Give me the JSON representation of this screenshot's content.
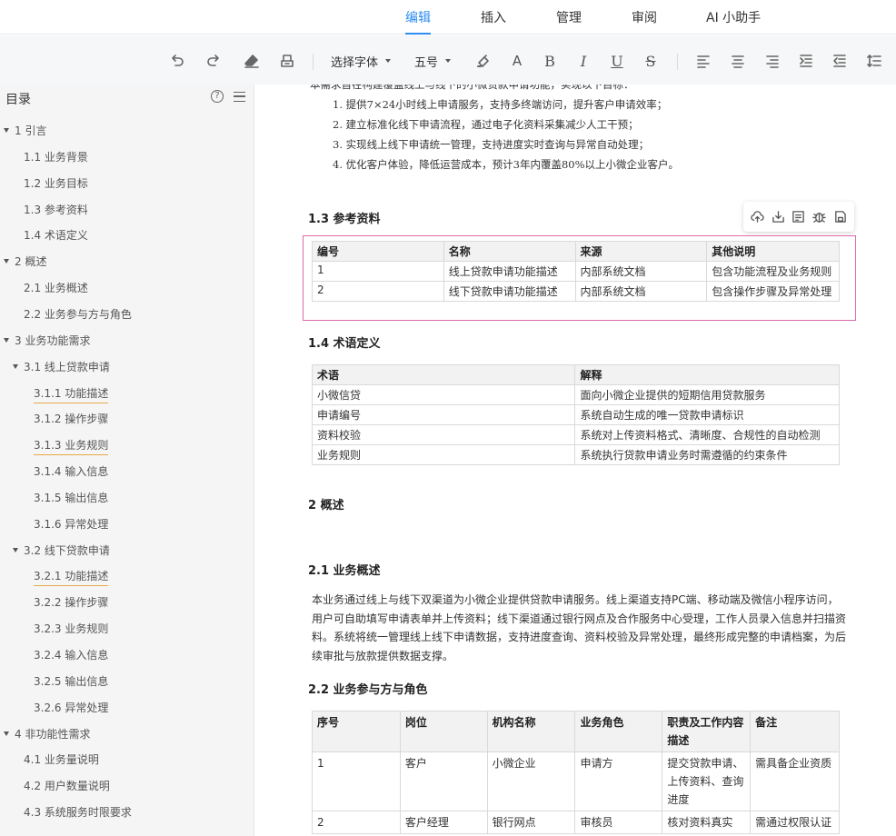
{
  "menu": {
    "tabs": [
      {
        "label": "编辑"
      },
      {
        "label": "插入"
      },
      {
        "label": "管理"
      },
      {
        "label": "审阅"
      },
      {
        "label": "AI 小助手"
      }
    ],
    "active_index": 0
  },
  "toolbar": {
    "font_select": "选择字体",
    "size_select": "五号",
    "color_text": "A",
    "bold": "B",
    "italic": "I",
    "underline": "U",
    "strike": "S"
  },
  "sidebar": {
    "title": "目录",
    "help_glyph": "?",
    "toc": [
      {
        "label": "1 引言",
        "level": 1,
        "expanded": true
      },
      {
        "label": "1.1 业务背景",
        "level": 2
      },
      {
        "label": "1.2 业务目标",
        "level": 2
      },
      {
        "label": "1.3 参考资料",
        "level": 2
      },
      {
        "label": "1.4 术语定义",
        "level": 2
      },
      {
        "label": "2 概述",
        "level": 1,
        "expanded": true
      },
      {
        "label": "2.1 业务概述",
        "level": 2
      },
      {
        "label": "2.2 业务参与方与角色",
        "level": 2
      },
      {
        "label": "3 业务功能需求",
        "level": 1,
        "expanded": true
      },
      {
        "label": "3.1 线上贷款申请",
        "level": 2,
        "expanded": true
      },
      {
        "label": "3.1.1 功能描述",
        "level": 3,
        "underlined": true
      },
      {
        "label": "3.1.2 操作步骤",
        "level": 3
      },
      {
        "label": "3.1.3 业务规则",
        "level": 3,
        "underlined": true
      },
      {
        "label": "3.1.4 输入信息",
        "level": 3
      },
      {
        "label": "3.1.5 输出信息",
        "level": 3
      },
      {
        "label": "3.1.6 异常处理",
        "level": 3
      },
      {
        "label": "3.2 线下贷款申请",
        "level": 2,
        "expanded": true
      },
      {
        "label": "3.2.1 功能描述",
        "level": 3,
        "underlined": true
      },
      {
        "label": "3.2.2 操作步骤",
        "level": 3
      },
      {
        "label": "3.2.3 业务规则",
        "level": 3
      },
      {
        "label": "3.2.4 输入信息",
        "level": 3
      },
      {
        "label": "3.2.5 输出信息",
        "level": 3
      },
      {
        "label": "3.2.6 异常处理",
        "level": 3
      },
      {
        "label": "4 非功能性需求",
        "level": 1,
        "expanded": true
      },
      {
        "label": "4.1 业务量说明",
        "level": 2
      },
      {
        "label": "4.2 用户数量说明",
        "level": 2
      },
      {
        "label": "4.3 系统服务时限要求",
        "level": 2
      }
    ]
  },
  "doc": {
    "intro_cut": "本需求旨在构建覆盖线上与线下的小微贷款申请功能，实现以下目标：",
    "goals": [
      "1. 提供7×24小时线上申请服务，支持多终端访问，提升客户申请效率；",
      "2. 建立标准化线下申请流程，通过电子化资料采集减少人工干预；",
      "3. 实现线上线下申请统一管理，支持进度实时查询与异常自动处理；",
      "4. 优化客户体验，降低运营成本，预计3年内覆盖80%以上小微企业客户。"
    ],
    "sec_1_3": {
      "heading": "1.3 参考资料",
      "headers": [
        "编号",
        "名称",
        "来源",
        "其他说明"
      ],
      "rows": [
        [
          "1",
          "线上贷款申请功能描述",
          "内部系统文档",
          "包含功能流程及业务规则"
        ],
        [
          "2",
          "线下贷款申请功能描述",
          "内部系统文档",
          "包含操作步骤及异常处理"
        ]
      ]
    },
    "sec_1_4": {
      "heading": "1.4 术语定义",
      "headers": [
        "术语",
        "解释"
      ],
      "rows": [
        [
          "小微信贷",
          "面向小微企业提供的短期信用贷款服务"
        ],
        [
          "申请编号",
          "系统自动生成的唯一贷款申请标识"
        ],
        [
          "资料校验",
          "系统对上传资料格式、清晰度、合规性的自动检测"
        ],
        [
          "业务规则",
          "系统执行贷款申请业务时需遵循的约束条件"
        ]
      ]
    },
    "sec_2": {
      "heading": "2 概述"
    },
    "sec_2_1": {
      "heading": "2.1 业务概述",
      "body": "本业务通过线上与线下双渠道为小微企业提供贷款申请服务。线上渠道支持PC端、移动端及微信小程序访问，用户可自助填写申请表单并上传资料；线下渠道通过银行网点及合作服务中心受理，工作人员录入信息并扫描资料。系统将统一管理线上线下申请数据，支持进度查询、资料校验及异常处理，最终形成完整的申请档案，为后续审批与放款提供数据支撑。"
    },
    "sec_2_2": {
      "heading": "2.2 业务参与方与角色",
      "headers": [
        "序号",
        "岗位",
        "机构名称",
        "业务角色",
        "职责及工作内容描述",
        "备注"
      ],
      "rows": [
        [
          "1",
          "客户",
          "小微企业",
          "申请方",
          "提交贷款申请、上传资料、查询进度",
          "需具备企业资质"
        ],
        [
          "2",
          "客户经理",
          "银行网点",
          "审核员",
          "核对资料真实",
          "需通过权限认证"
        ]
      ]
    }
  }
}
